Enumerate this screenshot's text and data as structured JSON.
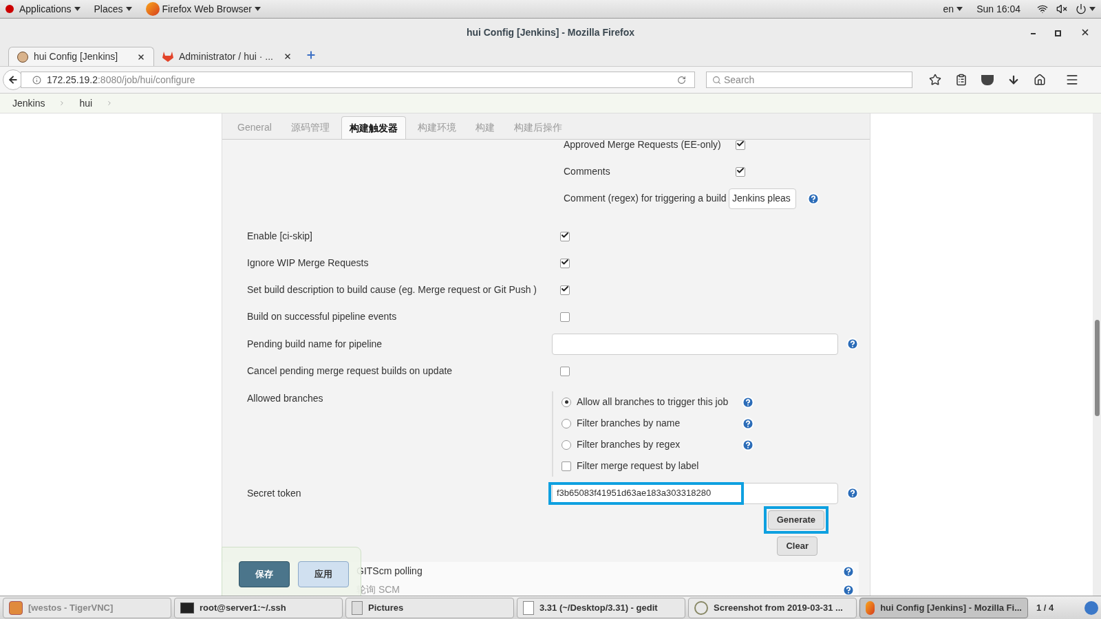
{
  "top_bar": {
    "menus": [
      "Applications",
      "Places",
      "Firefox Web Browser"
    ],
    "language": "en",
    "clock": "Sun 16:04"
  },
  "window": {
    "title": "hui Config [Jenkins] - Mozilla Firefox"
  },
  "browser_tabs": [
    {
      "label": "hui Config [Jenkins]",
      "selected": true
    },
    {
      "label": "Administrator / hui · ...",
      "selected": false
    }
  ],
  "address": {
    "host": "172.25.19.2",
    "path": ":8080/job/hui/configure"
  },
  "search": {
    "placeholder": "Search"
  },
  "breadcrumb": [
    "Jenkins",
    "hui"
  ],
  "section_tabs": [
    {
      "label": "General",
      "selected": false
    },
    {
      "label": "源码管理",
      "selected": false
    },
    {
      "label": "构建触发器",
      "selected": true
    },
    {
      "label": "构建环境",
      "selected": false
    },
    {
      "label": "构建",
      "selected": false
    },
    {
      "label": "构建后操作",
      "selected": false
    }
  ],
  "sub_options": [
    {
      "label": "Approved Merge Requests (EE-only)",
      "kind": "checkbox",
      "checked": true
    },
    {
      "label": "Comments",
      "kind": "checkbox",
      "checked": true
    },
    {
      "label": "Comment (regex) for triggering a build",
      "kind": "text",
      "value": "Jenkins pleas"
    }
  ],
  "options": [
    {
      "label": "Enable [ci-skip]",
      "kind": "checkbox",
      "checked": true
    },
    {
      "label": "Ignore WIP Merge Requests",
      "kind": "checkbox",
      "checked": true
    },
    {
      "label": "Set build description to build cause (eg. Merge request or Git Push )",
      "kind": "checkbox",
      "checked": true
    },
    {
      "label": "Build on successful pipeline events",
      "kind": "checkbox",
      "checked": false
    },
    {
      "label": "Pending build name for pipeline",
      "kind": "text"
    },
    {
      "label": "Cancel pending merge request builds on update",
      "kind": "checkbox",
      "checked": false
    }
  ],
  "allowed_branches": {
    "label": "Allowed branches",
    "choices": [
      {
        "label": "Allow all branches to trigger this job",
        "selected": true
      },
      {
        "label": "Filter branches by name",
        "selected": false
      },
      {
        "label": "Filter branches by regex",
        "selected": false
      }
    ],
    "label_filter": {
      "label": "Filter merge request by label",
      "checked": false
    }
  },
  "secret_token": {
    "label": "Secret token",
    "value": "f3b65083f41951d63ae183a303318280",
    "highlighted": true
  },
  "buttons": [
    {
      "label": "Generate",
      "highlighted": true
    },
    {
      "label": "Clear",
      "highlighted": false
    }
  ],
  "more_options": [
    {
      "label": "GITScm polling"
    },
    {
      "label": "轮询 SCM"
    }
  ],
  "save_bar": [
    "保存",
    "应用"
  ],
  "taskbar": [
    {
      "label": "[westos - TigerVNC]",
      "selected": false
    },
    {
      "label": "root@server1:~/.ssh",
      "selected": false
    },
    {
      "label": "Pictures",
      "selected": false
    },
    {
      "label": "3.31 (~/Desktop/3.31) - gedit",
      "selected": false
    },
    {
      "label": "Screenshot from 2019-03-31 ...",
      "selected": false
    },
    {
      "label": "hui Config [Jenkins] - Mozilla Fi...",
      "selected": true
    }
  ],
  "workspace_pager": "1 / 4"
}
